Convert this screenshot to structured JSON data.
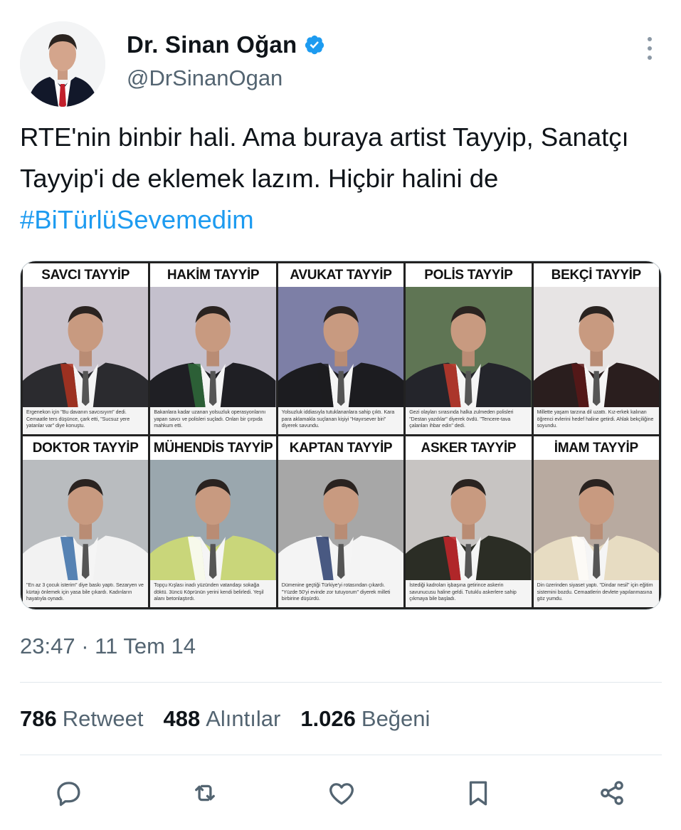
{
  "tweet": {
    "display_name": "Dr. Sinan Oğan",
    "handle": "@DrSinanOgan",
    "text_plain": "RTE'nin binbir hali. Ama buraya artist Tayyip, Sanatçı Tayyip'i de eklemek lazım. Hiçbir halini de ",
    "hashtag": "#BiTürlüSevemedim",
    "timestamp": "23:47 · 11 Tem 14"
  },
  "media": {
    "panels": [
      {
        "title": "SAVCI TAYYİP",
        "caption": "Ergenekon için \"Bu davanın savcısıyım\" dedi. Cemaatle ters düşünce, çark etti, \"Sucsuz yere yatanlar var\" diye konuştu.",
        "bg": "#c9c3cc",
        "coat": "#2b2b2f",
        "accent": "#b0331f"
      },
      {
        "title": "HAKİM TAYYİP",
        "caption": "Bakanlara kadar uzanan yolsuzluk operasyonlarını yapan savcı ve polisleri suçladı. Onları bir çırpıda mahkum etti.",
        "bg": "#c4c0cd",
        "coat": "#1f1f24",
        "accent": "#2f6b3a"
      },
      {
        "title": "AVUKAT TAYYİP",
        "caption": "Yolsuzluk iddiasıyla tutuklananlara sahip çıktı. Kara para aklamakla suçlanan kişiyi \"Hayırsever biri\" diyerek savundu.",
        "bg": "#7d7fa6",
        "coat": "#1c1c20",
        "accent": "#1c1c20"
      },
      {
        "title": "POLİS TAYYİP",
        "caption": "Gezi olayları sırasında halka zulmeden polisleri \"Destan yazdılar\" diyerek övdü. \"Tencere-tava çalanları ihbar edin\" dedi.",
        "bg": "#5f7554",
        "coat": "#24252b",
        "accent": "#c33a2c"
      },
      {
        "title": "BEKÇİ TAYYİP",
        "caption": "Millette yaşam tarzına dil uzattı. Kız-erkek kalınan öğrenci evlerini hedef haline getirdi. Ahlak bekçiliğine soyundu.",
        "bg": "#e7e4e4",
        "coat": "#2a1e1e",
        "accent": "#5a1818"
      },
      {
        "title": "DOKTOR TAYYİP",
        "caption": "\"En az 3 çocuk isterim\" diye baskı yaptı. Sezaryen ve kürtajı önlemek için yasa bile çıkardı. Kadınların hayatıyla oynadı.",
        "bg": "#b9bcbf",
        "coat": "#f2f2f2",
        "accent": "#3b6ea8"
      },
      {
        "title": "MÜHENDİS TAYYİP",
        "caption": "Topçu Kışlası inadı yüzünden vatandaşı sokağa döktü. 3üncü Köprünün yerini kendi belirledi. Yeşil alanı betonlaştırdı.",
        "bg": "#9aa7ae",
        "coat": "#c9d67a",
        "accent": "#ffffff"
      },
      {
        "title": "KAPTAN TAYYİP",
        "caption": "Dümenine geçtiği Türkiye'yi rotasından çıkardı. \"Yüzde 50'yi evinde zor tutuyorum\" diyerek milleti birbirine düşürdü.",
        "bg": "#a7a7a7",
        "coat": "#f4f4f4",
        "accent": "#2a3d6d"
      },
      {
        "title": "ASKER TAYYİP",
        "caption": "İstediği kadroları işbaşına getirince askerin savunucusu haline geldi. Tutuklu askerlere sahip çıkmaya bile başladı.",
        "bg": "#c7c4c2",
        "coat": "#2b2d25",
        "accent": "#c8262a"
      },
      {
        "title": "İMAM TAYYİP",
        "caption": "Din üzerinden siyaset yaptı. \"Dindar nesil\" için eğitim sistemini bozdu. Cemaatlerin devlete yapılanmasına göz yumdu.",
        "bg": "#b8aaa0",
        "coat": "#e7dcc2",
        "accent": "#ffffff"
      }
    ]
  },
  "stats": {
    "retweets": {
      "count": "786",
      "label": "Retweet"
    },
    "quotes": {
      "count": "488",
      "label": "Alıntılar"
    },
    "likes": {
      "count": "1.026",
      "label": "Beğeni"
    }
  },
  "icons": {
    "verified": "verified-badge-icon",
    "more": "more-vertical-icon",
    "reply": "reply-icon",
    "retweet": "retweet-icon",
    "like": "heart-icon",
    "bookmark": "bookmark-icon",
    "share": "share-icon"
  },
  "colors": {
    "accent": "#1d9bf0",
    "secondary_text": "#536471",
    "primary_text": "#0f1419"
  }
}
